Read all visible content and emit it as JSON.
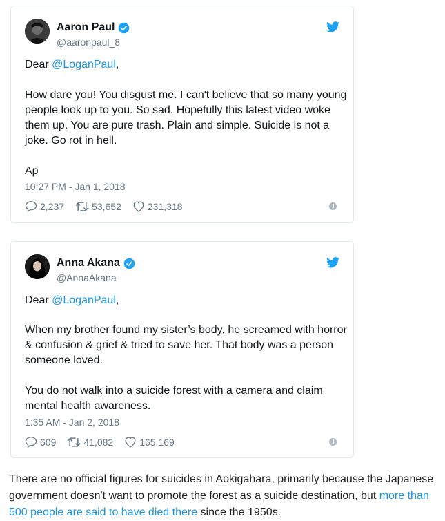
{
  "tweets": [
    {
      "name": "Aaron Paul",
      "handle": "@aaronpaul_8",
      "greeting": "Dear ",
      "mention": "@LoganPaul",
      "greeting_end": ",",
      "body": "How dare you! You disgust me. I can't believe that so many young people look up to you. So sad. Hopefully this latest video woke them up. You are pure trash. Plain and simple. Suicide is not a joke. Go rot in hell.\n\nAp",
      "time": "10:27 PM - Jan 1, 2018",
      "replies": "2,237",
      "retweets": "53,652",
      "likes": "231,318"
    },
    {
      "name": "Anna Akana",
      "handle": "@AnnaAkana",
      "greeting": "Dear ",
      "mention": "@LoganPaul",
      "greeting_end": ",",
      "body": "When my brother found my sister’s body, he screamed with horror & confusion & grief & tried to save her. That body was a person someone loved.\n\nYou do not walk into a suicide forest with a camera and claim mental health awareness.",
      "time": "1:35 AM - Jan 2, 2018",
      "replies": "609",
      "retweets": "41,082",
      "likes": "165,169"
    }
  ],
  "article": {
    "text_before": "There are no official figures for suicides in Aokigahara, primarily because the Japanese government doesn't want to promote the forest as a suicide destination, but ",
    "link": "more than 500 people are said to have died there",
    "text_after": " since the 1950s."
  },
  "colors": {
    "link": "#1b95e0",
    "muted": "#657786",
    "verified": "#1da1f2"
  }
}
